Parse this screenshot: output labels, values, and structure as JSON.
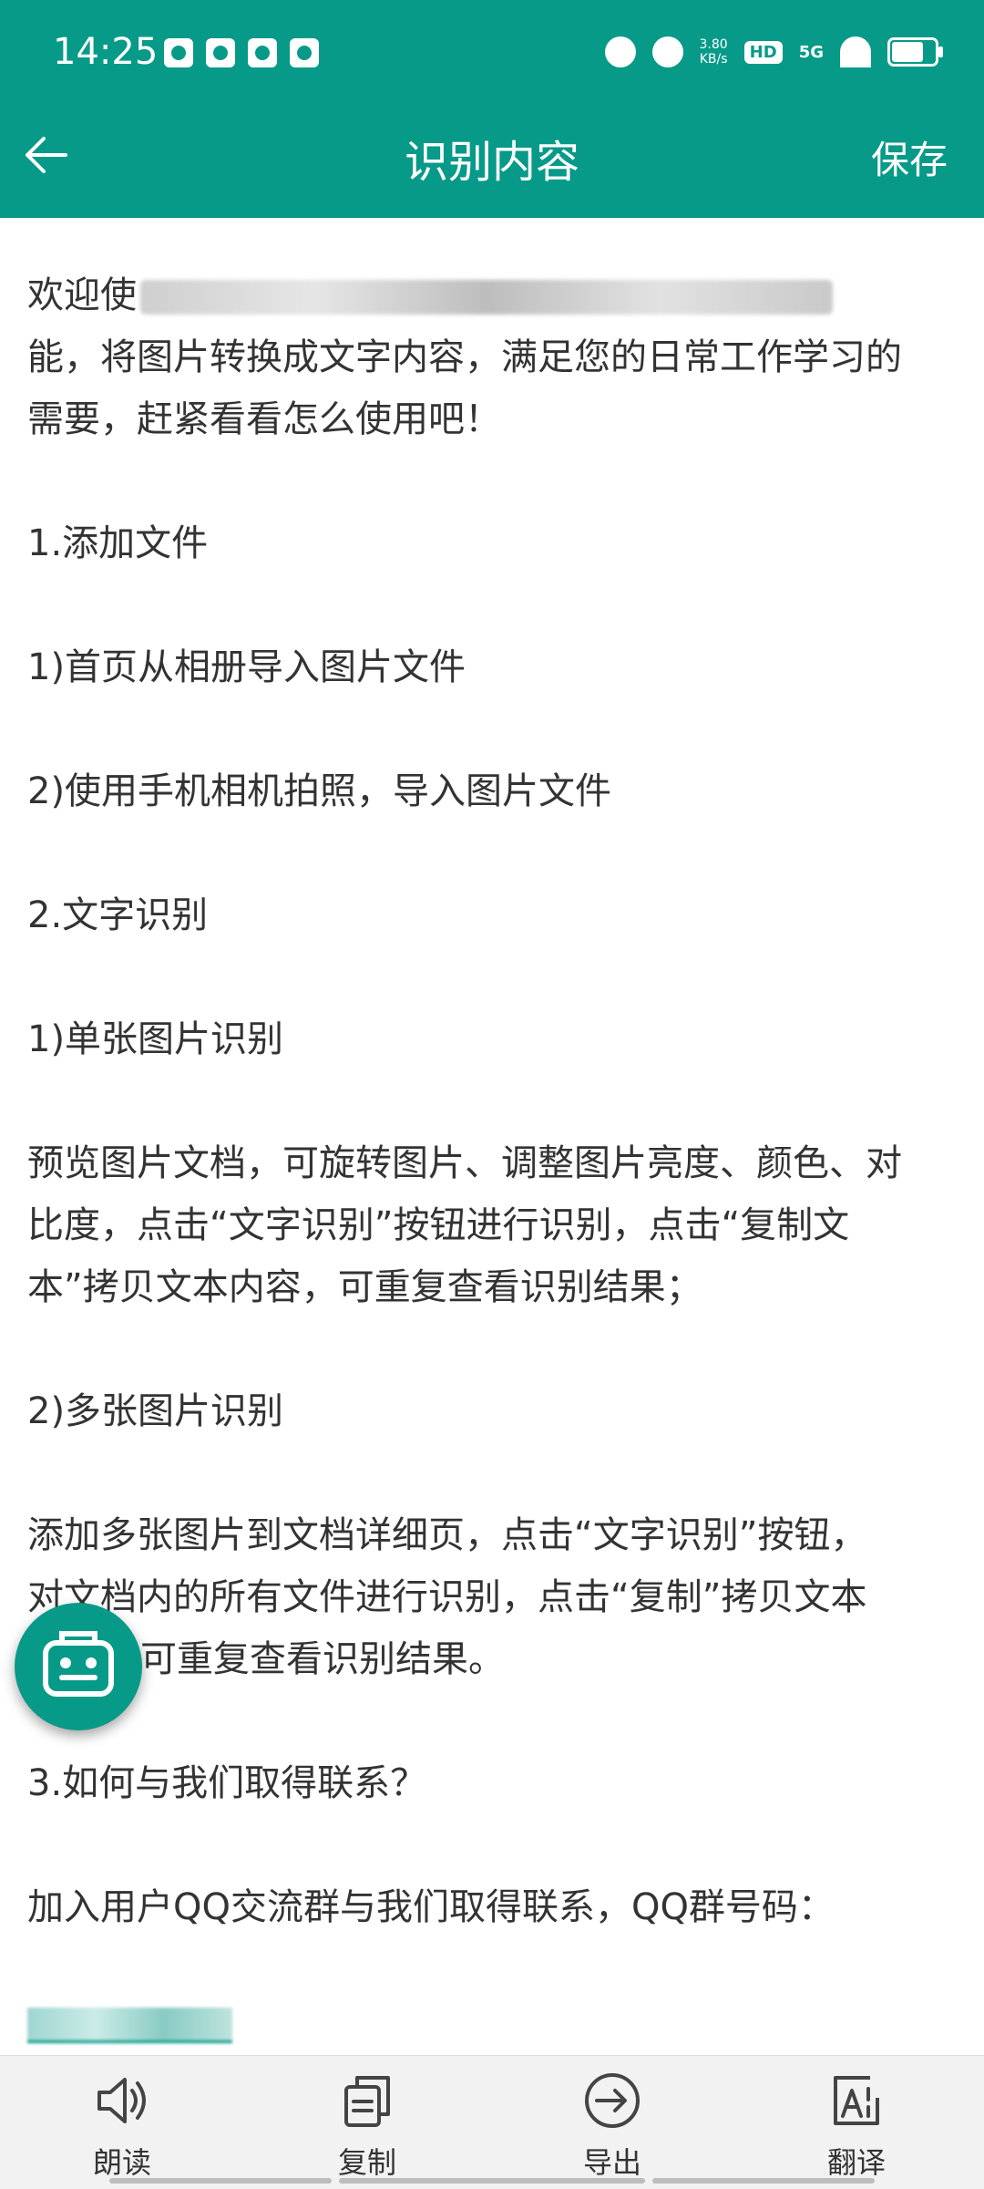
{
  "status_bar": {
    "time": "14:25",
    "net_speed": "3.80\nKB/s",
    "hd": "HD",
    "signal": "5G"
  },
  "header": {
    "title": "识别内容",
    "save": "保存"
  },
  "content": {
    "intro_visible_start": "欢迎使",
    "intro_line2": "能，将图片转换成文字内容，满足您的日常工作学习的",
    "intro_line3": "需要，赶紧看看怎么使用吧！",
    "s1": "1.添加文件",
    "s1a": "1)首页从相册导入图片文件",
    "s1b": "2)使用手机相机拍照，导入图片文件",
    "s2": "2.文字识别",
    "s2a": "1)单张图片识别",
    "p1_l1": "预览图片文档，可旋转图片、调整图片亮度、颜色、对",
    "p1_l2": "比度，点击“文字识别”按钮进行识别，点击“复制文",
    "p1_l3": "本”拷贝文本内容，可重复查看识别结果；",
    "s2b": "2)多张图片识别",
    "p2_l1": "添加多张图片到文档详细页，点击“文字识别”按钮，",
    "p2_l2": "对文档内的所有文件进行识别，点击“复制”拷贝文本",
    "p2_l3": "可重复查看识别结果。",
    "s3": "3.如何与我们取得联系？",
    "p3": "加入用户QQ交流群与我们取得联系，QQ群号码："
  },
  "bottom_nav": [
    {
      "label": "朗读",
      "icon": "speaker-icon"
    },
    {
      "label": "复制",
      "icon": "copy-icon"
    },
    {
      "label": "导出",
      "icon": "export-icon"
    },
    {
      "label": "翻译",
      "icon": "translate-icon"
    }
  ],
  "colors": {
    "primary": "#079a88",
    "text": "#333333",
    "bottom_bar": "#f2f2f2"
  }
}
